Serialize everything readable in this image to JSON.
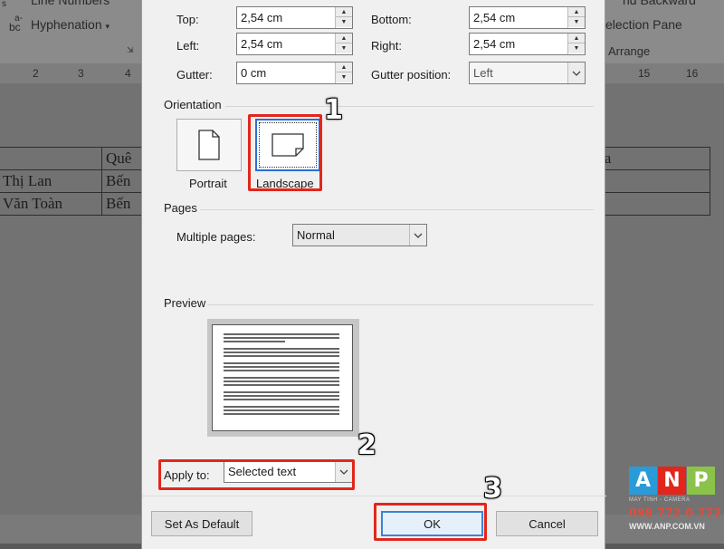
{
  "ribbon": {
    "line_numbers": "Line Numbers",
    "hyphenation": "Hyphenation",
    "bc": "bc",
    "a_small": "a-",
    "send_backward": "nd Backward",
    "selection_pane": "election Pane",
    "arrange": "Arrange"
  },
  "ruler": {
    "left_marks": [
      "2",
      "3",
      "4"
    ],
    "right_marks": [
      "15",
      "16"
    ]
  },
  "document": {
    "table_rows": [
      [
        "",
        "Quê",
        "",
        "ja"
      ],
      [
        "Thị Lan",
        "Bến",
        "",
        ""
      ],
      [
        "Văn Toàn",
        "Bến",
        "",
        ""
      ]
    ]
  },
  "dialog": {
    "margins": {
      "top_label": "Top:",
      "top_value": "2,54 cm",
      "bottom_label": "Bottom:",
      "bottom_value": "2,54 cm",
      "left_label": "Left:",
      "left_value": "2,54 cm",
      "right_label": "Right:",
      "right_value": "2,54 cm",
      "gutter_label": "Gutter:",
      "gutter_value": "0 cm",
      "gutter_position_label": "Gutter position:",
      "gutter_position_value": "Left"
    },
    "orientation": {
      "title": "Orientation",
      "portrait": "Portrait",
      "landscape": "Landscape",
      "selected": "landscape"
    },
    "pages": {
      "title": "Pages",
      "multiple_pages_label": "Multiple pages:",
      "multiple_pages_value": "Normal"
    },
    "preview": {
      "title": "Preview"
    },
    "apply_to": {
      "label": "Apply to:",
      "value": "Selected text"
    },
    "buttons": {
      "set_default": "Set As Default",
      "ok": "OK",
      "cancel": "Cancel"
    }
  },
  "annotations": {
    "step1": "1",
    "step2": "2",
    "step3": "3",
    "color": "#e2261b"
  },
  "logo": {
    "letters": [
      "A",
      "N",
      "P"
    ],
    "tagline": "MAY TINH - CAMERA",
    "phone": "098 772 0 772",
    "website": "WWW.ANP.COM.VN",
    "colors": [
      "#2a9bd8",
      "#e2261b",
      "#8bc34a"
    ]
  }
}
